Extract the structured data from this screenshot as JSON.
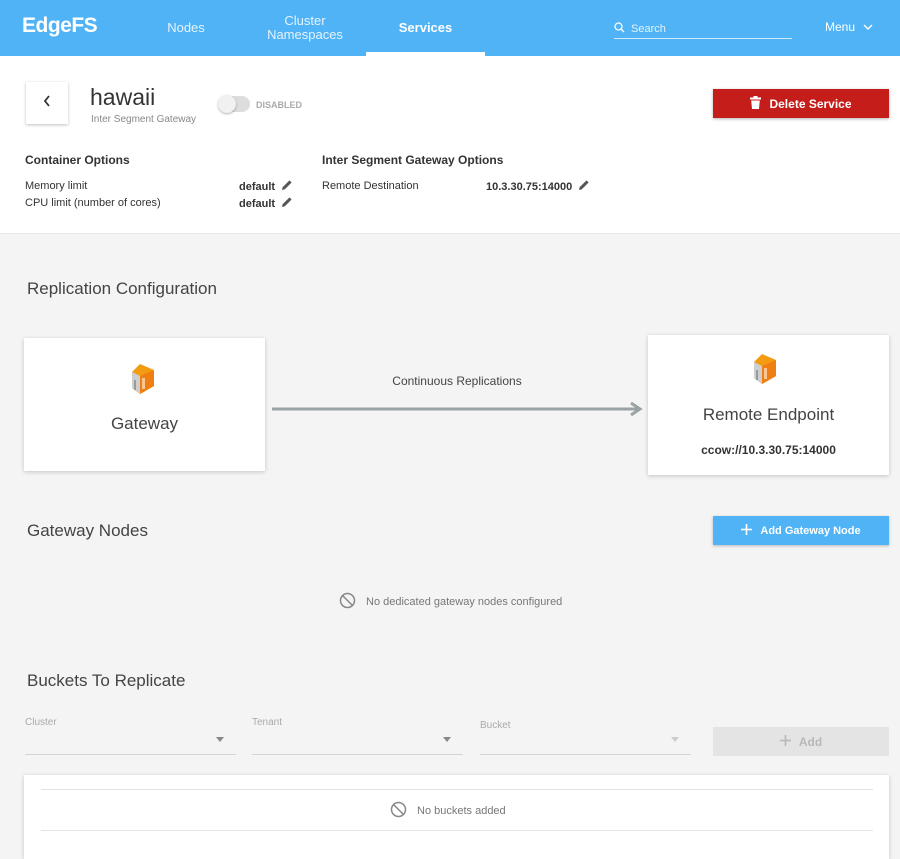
{
  "app": {
    "logo": "EdgeFS",
    "nav": [
      {
        "label": "Nodes"
      },
      {
        "label": "Cluster Namespaces"
      },
      {
        "label": "Services",
        "active": true
      }
    ],
    "search_placeholder": "Search",
    "menu_label": "Menu",
    "accent_color": "#4fb3f6"
  },
  "service": {
    "name": "hawaii",
    "type": "Inter Segment Gateway",
    "status": "DISABLED",
    "enabled": false,
    "delete_label": "Delete Service",
    "delete_color": "#c41d1a"
  },
  "container_options": {
    "heading": "Container Options",
    "rows": [
      {
        "label": "Memory limit",
        "value": "default"
      },
      {
        "label": "CPU limit (number of cores)",
        "value": "default"
      }
    ]
  },
  "gateway_options": {
    "heading": "Inter Segment Gateway Options",
    "rows": [
      {
        "label": "Remote Destination",
        "value": "10.3.30.75:14000"
      }
    ]
  },
  "replication": {
    "title": "Replication Configuration",
    "source_label": "Gateway",
    "link_label": "Continuous Replications",
    "target_label": "Remote Endpoint",
    "target_address": "ccow://10.3.30.75:14000"
  },
  "gateway_nodes": {
    "title": "Gateway Nodes",
    "add_label": "Add Gateway Node",
    "empty_message": "No dedicated gateway nodes configured"
  },
  "buckets": {
    "title": "Buckets To Replicate",
    "fields": [
      {
        "label": "Cluster",
        "value": ""
      },
      {
        "label": "Tenant",
        "value": ""
      },
      {
        "label": "Bucket",
        "value": ""
      }
    ],
    "add_label": "Add",
    "empty_message": "No buckets added"
  }
}
